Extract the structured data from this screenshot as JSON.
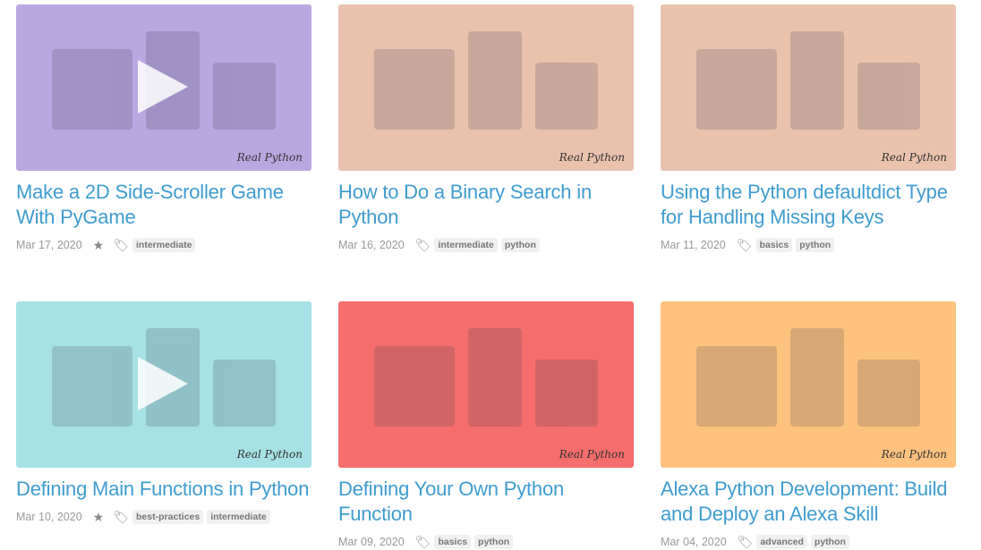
{
  "watermark": "Real Python",
  "articles": [
    {
      "title": "Make a 2D Side-Scroller Game With PyGame",
      "date": "Mar 17, 2020",
      "starred": true,
      "video": true,
      "tags": [
        "intermediate"
      ],
      "bg": "#b9a7e0"
    },
    {
      "title": "How to Do a Binary Search in Python",
      "date": "Mar 16, 2020",
      "starred": false,
      "video": false,
      "tags": [
        "intermediate",
        "python"
      ],
      "bg": "#e9c2ae"
    },
    {
      "title": "Using the Python defaultdict Type for Handling Missing Keys",
      "date": "Mar 11, 2020",
      "starred": false,
      "video": false,
      "tags": [
        "basics",
        "python"
      ],
      "bg": "#e9c3ae"
    },
    {
      "title": "Defining Main Functions in Python",
      "date": "Mar 10, 2020",
      "starred": true,
      "video": true,
      "tags": [
        "best-practices",
        "intermediate"
      ],
      "bg": "#a6e1e5"
    },
    {
      "title": "Defining Your Own Python Function",
      "date": "Mar 09, 2020",
      "starred": false,
      "video": false,
      "tags": [
        "basics",
        "python"
      ],
      "bg": "#f66d6d"
    },
    {
      "title": "Alexa Python Development: Build and Deploy an Alexa Skill",
      "date": "Mar 04, 2020",
      "starred": false,
      "video": false,
      "tags": [
        "advanced",
        "python"
      ],
      "bg": "#fdc27e"
    }
  ]
}
